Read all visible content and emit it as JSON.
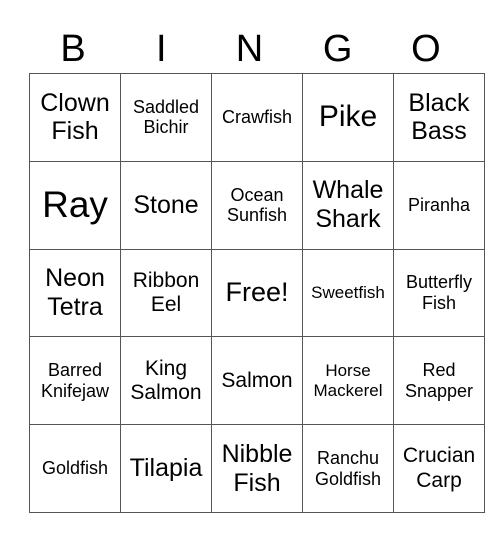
{
  "header": [
    "B",
    "I",
    "N",
    "G",
    "O"
  ],
  "rows": [
    [
      {
        "text": "Clown Fish",
        "size": "s-m"
      },
      {
        "text": "Saddled Bichir",
        "size": "s-s"
      },
      {
        "text": "Crawfish",
        "size": "s-s"
      },
      {
        "text": "Pike",
        "size": "s-l"
      },
      {
        "text": "Black Bass",
        "size": "s-m"
      }
    ],
    [
      {
        "text": "Ray",
        "size": "s-xl"
      },
      {
        "text": "Stone",
        "size": "s-m"
      },
      {
        "text": "Ocean Sunfish",
        "size": "s-s"
      },
      {
        "text": "Whale Shark",
        "size": "s-m"
      },
      {
        "text": "Piranha",
        "size": "s-s"
      }
    ],
    [
      {
        "text": "Neon Tetra",
        "size": "s-m"
      },
      {
        "text": "Ribbon Eel",
        "size": "s-sm"
      },
      {
        "text": "Free!",
        "size": "s-ml"
      },
      {
        "text": "Sweetfish",
        "size": "s-xs"
      },
      {
        "text": "Butterfly Fish",
        "size": "s-s"
      }
    ],
    [
      {
        "text": "Barred Knifejaw",
        "size": "s-s"
      },
      {
        "text": "King Salmon",
        "size": "s-sm"
      },
      {
        "text": "Salmon",
        "size": "s-sm"
      },
      {
        "text": "Horse Mackerel",
        "size": "s-xs"
      },
      {
        "text": "Red Snapper",
        "size": "s-s"
      }
    ],
    [
      {
        "text": "Goldfish",
        "size": "s-s"
      },
      {
        "text": "Tilapia",
        "size": "s-m"
      },
      {
        "text": "Nibble Fish",
        "size": "s-m"
      },
      {
        "text": "Ranchu Goldfish",
        "size": "s-s"
      },
      {
        "text": "Crucian Carp",
        "size": "s-sm"
      }
    ]
  ]
}
